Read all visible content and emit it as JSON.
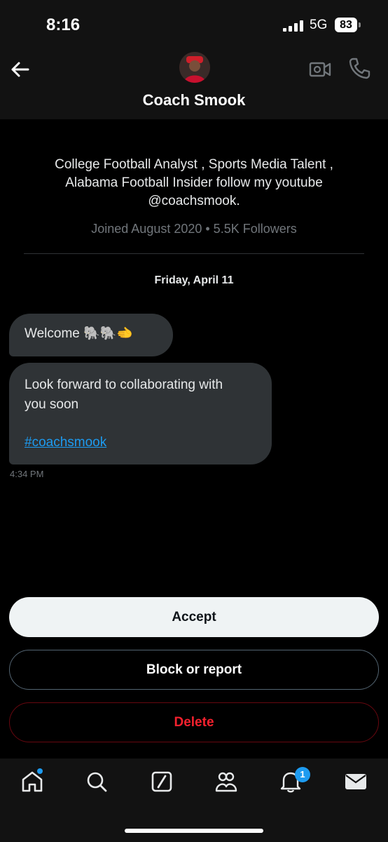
{
  "status_bar": {
    "time": "8:16",
    "network": "5G",
    "battery": "83"
  },
  "header": {
    "title": "Coach Smook"
  },
  "profile": {
    "bio": "College Football Analyst , Sports Media Talent , Alabama Football Insider follow my youtube @coachsmook.",
    "meta": "Joined August 2020 • 5.5K Followers"
  },
  "conversation": {
    "date": "Friday, April 11",
    "messages": [
      {
        "text": "Welcome 🐘🐘🫲"
      },
      {
        "line1": "Look forward to collaborating with",
        "line2": "you soon",
        "hashtag": "#coachsmook"
      }
    ],
    "timestamp": "4:34 PM"
  },
  "actions": {
    "accept": "Accept",
    "block": "Block or report",
    "delete": "Delete"
  },
  "tabbar": {
    "icons": [
      "home-icon",
      "search-icon",
      "grok-icon",
      "communities-icon",
      "notifications-icon",
      "messages-icon"
    ],
    "notifications_badge": "1"
  },
  "colors": {
    "accent": "#1d9bf0",
    "danger": "#f4212e",
    "bubble": "#2f3336"
  }
}
